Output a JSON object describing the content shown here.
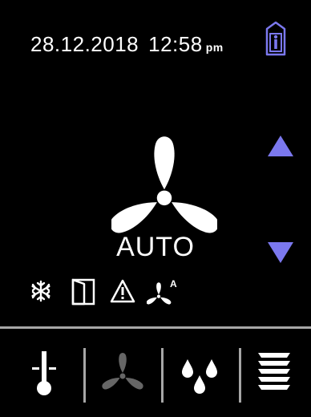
{
  "header": {
    "date": "28.12.2018",
    "time": "12:58",
    "ampm": "pm",
    "presence_icon": "person-in-door-icon"
  },
  "fan": {
    "mode": "AUTO",
    "icon": "fan-icon",
    "up_icon": "arrow-up-icon",
    "down_icon": "arrow-down-icon"
  },
  "status_icons": [
    "snowflake-icon",
    "window-open-icon",
    "warning-icon",
    "fan-auto-icon"
  ],
  "status_icon_labels": {
    "fan_auto_superscript": "A"
  },
  "tabs": [
    {
      "name": "temperature",
      "icon": "thermometer-icon",
      "active": false
    },
    {
      "name": "fan",
      "icon": "fan-icon",
      "active": true
    },
    {
      "name": "humidity",
      "icon": "droplets-icon",
      "active": false
    },
    {
      "name": "blinds",
      "icon": "blinds-icon",
      "active": false
    }
  ],
  "colors": {
    "background": "#000000",
    "text": "#ffffff",
    "accent": "#7b78ee",
    "inactive": "#666666",
    "divider": "#a6a6a6"
  }
}
